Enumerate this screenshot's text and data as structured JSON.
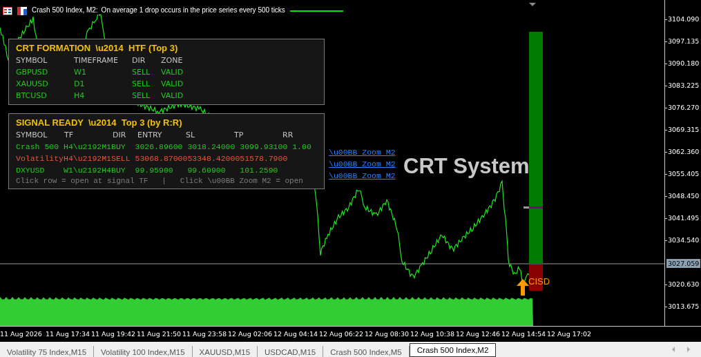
{
  "chart_header": {
    "title": "Crash 500 Index, M2:",
    "description": "On average 1 drop occurs in the price series every 500 ticks"
  },
  "htf_panel": {
    "title": "CRT FORMATION  \\u2014  HTF (Top 3)",
    "columns": [
      "SYMBOL",
      "TIMEFRAME",
      "DIR",
      "ZONE"
    ],
    "rows": [
      {
        "symbol": "GBPUSD",
        "timeframe": "W1",
        "dir": "SELL",
        "zone": "VALID"
      },
      {
        "symbol": "XAUUSD",
        "timeframe": "D1",
        "dir": "SELL",
        "zone": "VALID"
      },
      {
        "symbol": "BTCUSD",
        "timeframe": "H4",
        "dir": "SELL",
        "zone": "VALID"
      }
    ]
  },
  "signal_panel": {
    "title": "SIGNAL READY  \\u2014  Top 3 (by R:R)",
    "columns": [
      "SYMBOL",
      "TF",
      "DIR",
      "ENTRY",
      "SL",
      "TP",
      "RR"
    ],
    "rows": [
      {
        "symbol": "Crash 500",
        "tf": "H4\\u2192M1",
        "dir": "BUY",
        "entry": "3026.89600",
        "sl": "3018.24000",
        "tp": "3099.93100",
        "rr": "1.00",
        "link": "\\u00BB Zoom M2",
        "color": "#22c81e"
      },
      {
        "symbol": "Volatility",
        "tf": "H4\\u2192M1",
        "dir": "SELL",
        "entry": "53068.87000",
        "sl": "53348.42000",
        "tp": "51578.7900",
        "link": "\\u00BB Zoom M2",
        "color": "#e8543c"
      },
      {
        "symbol": "DXYUSD",
        "tf": "W1\\u2192H4",
        "dir": "BUY",
        "entry": "99.95900",
        "sl": "99.60900",
        "tp": "101.2590",
        "link": "\\u00BB Zoom M2",
        "color": "#22c81e"
      }
    ],
    "footer": "Click row = open at signal TF   |   Click \\u00BB Zoom M2 = open"
  },
  "overlay_title": "CRT System",
  "cisd_label": "CISD",
  "price_labels": [
    "3104.090",
    "3097.135",
    "3090.180",
    "3083.225",
    "3076.270",
    "3069.315",
    "3062.360",
    "3055.405",
    "3048.450",
    "3041.495",
    "3034.540",
    "3020.630",
    "3013.675"
  ],
  "current_price": "3027.059",
  "time_labels": [
    "11 Aug 2026",
    "11 Aug 17:34",
    "11 Aug 19:42",
    "11 Aug 21:50",
    "11 Aug 23:58",
    "12 Aug 02:06",
    "12 Aug 04:14",
    "12 Aug 06:22",
    "12 Aug 08:30",
    "12 Aug 10:38",
    "12 Aug 12:46",
    "12 Aug 14:54",
    "12 Aug 17:02"
  ],
  "tabs": [
    {
      "label": "Volatility 75 Index,M15",
      "selected": false
    },
    {
      "label": "Volatility 100 Index,M15",
      "selected": false
    },
    {
      "label": "XAUUSD,M15",
      "selected": false
    },
    {
      "label": "USDCAD,M15",
      "selected": false
    },
    {
      "label": "Crash 500 Index,M5",
      "selected": false
    },
    {
      "label": "Crash 500 Index,M2",
      "selected": true
    }
  ]
}
